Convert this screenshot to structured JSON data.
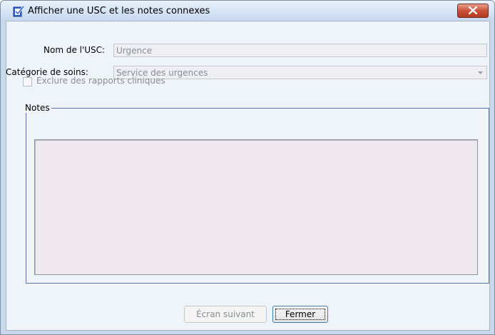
{
  "window": {
    "title": "Afficher une USC et les notes connexes",
    "icon": "check-document-icon",
    "close_icon": "close-icon"
  },
  "form": {
    "name_label": "Nom de l'USC:",
    "name_value": "Urgence",
    "category_label": "Catégorie de soins:",
    "category_value": "Service des urgences",
    "exclude_label": "Exclure des rapports cliniques",
    "exclude_checked": false
  },
  "notes": {
    "group_label": "Notes",
    "value": ""
  },
  "buttons": {
    "next_label": "Écran suivant",
    "close_label": "Fermer"
  },
  "colors": {
    "frame": "#c9d9ec",
    "close_button": "#c9513a",
    "notes_background": "#efe8ee"
  }
}
